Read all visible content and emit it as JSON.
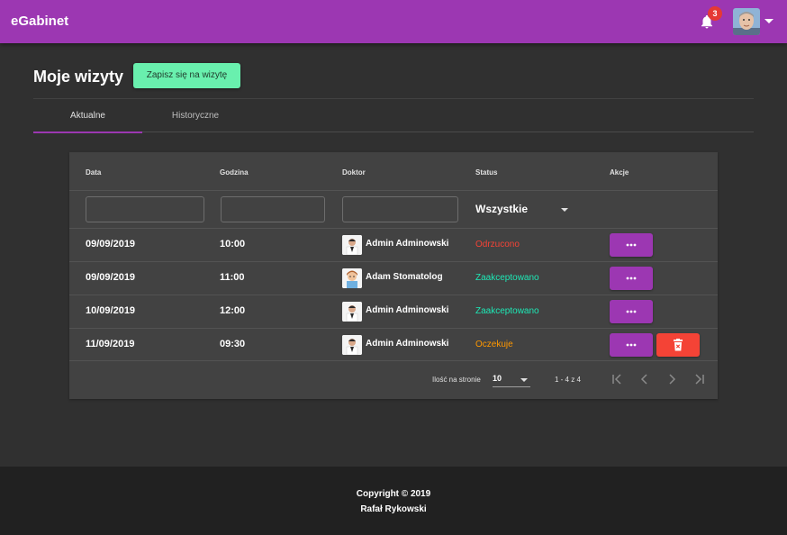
{
  "app": {
    "title": "eGabinet"
  },
  "header": {
    "notifications_count": "3",
    "icons": [
      "bell-icon",
      "avatar",
      "caret-down-icon"
    ]
  },
  "page": {
    "title": "Moje wizyty",
    "book_button": "Zapisz się na wizytę"
  },
  "tabs": [
    {
      "label": "Aktualne",
      "active": true
    },
    {
      "label": "Historyczne",
      "active": false
    }
  ],
  "table": {
    "columns": {
      "date": "Data",
      "time": "Godzina",
      "doctor": "Doktor",
      "status": "Status",
      "actions": "Akcje"
    },
    "filters": {
      "date": "",
      "time": "",
      "doctor": "",
      "status": "Wszystkie"
    },
    "rows": [
      {
        "date": "09/09/2019",
        "time": "10:00",
        "doctor": "Admin Adminowski",
        "status": "Odrzucono",
        "status_color": "#f44336",
        "photo": "doctor-photo-1",
        "deletable": false
      },
      {
        "date": "09/09/2019",
        "time": "11:00",
        "doctor": "Adam Stomatolog",
        "status": "Zaakceptowano",
        "status_color": "#1de9b6",
        "photo": "doctor-photo-2",
        "deletable": false
      },
      {
        "date": "10/09/2019",
        "time": "12:00",
        "doctor": "Admin Adminowski",
        "status": "Zaakceptowano",
        "status_color": "#1de9b6",
        "photo": "doctor-photo-1",
        "deletable": false
      },
      {
        "date": "11/09/2019",
        "time": "09:30",
        "doctor": "Admin Adminowski",
        "status": "Oczekuje",
        "status_color": "#ff9800",
        "photo": "doctor-photo-1",
        "deletable": true
      }
    ]
  },
  "pagination": {
    "items_per_page_label": "Ilość na stronie",
    "items_per_page": "10",
    "range": "1 - 4 z 4"
  },
  "footer": {
    "copyright": "Copyright © 2019",
    "author": "Rafał Rykowski"
  },
  "colors": {
    "primary": "#9c37b2",
    "accent": "#69f0ae",
    "warn": "#f44336",
    "background": "#303030",
    "card": "#424242"
  }
}
